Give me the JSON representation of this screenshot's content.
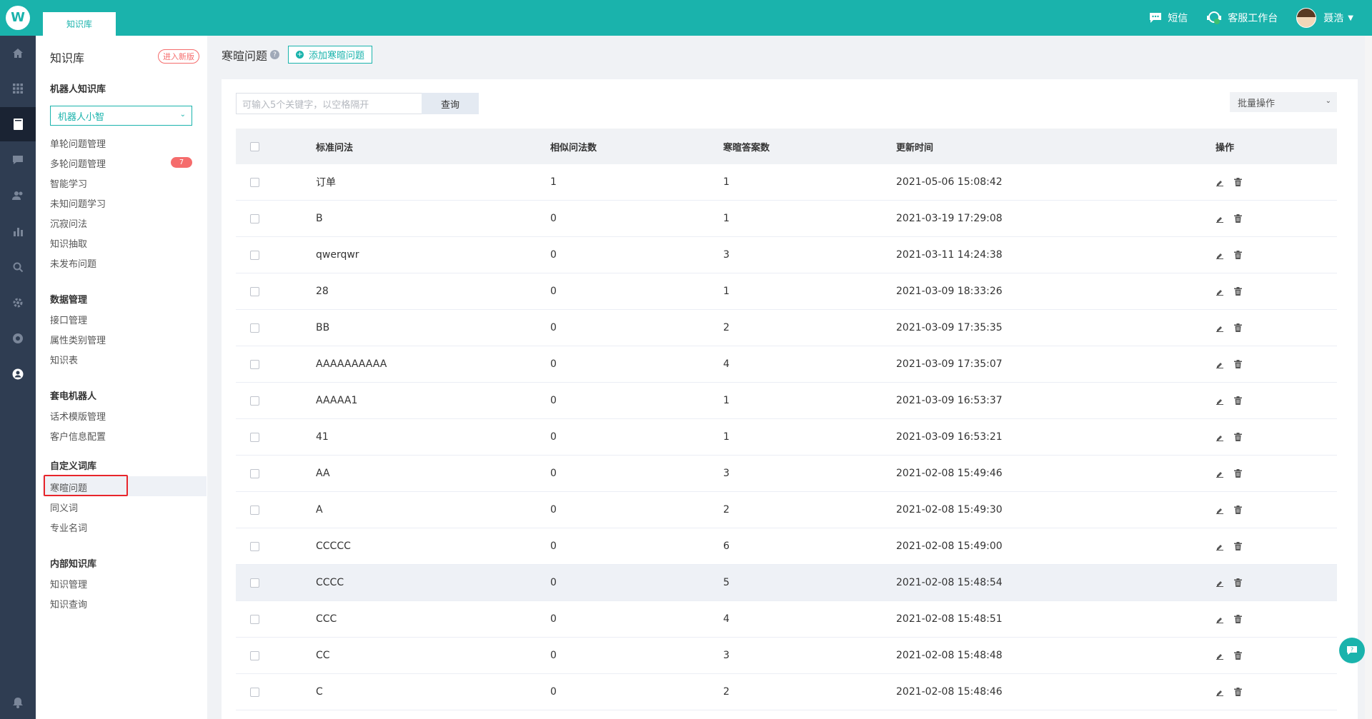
{
  "app": {
    "logo_icon": "tooth-logo-icon",
    "tab_label": "知识库",
    "accent_color": "#1ab3ac"
  },
  "header": {
    "sms_label": "短信",
    "workbench_label": "客服工作台",
    "user_name": "聂浩"
  },
  "rail": {
    "icons": [
      "home-icon",
      "apps-icon",
      "book-icon",
      "chat-icon",
      "users-icon",
      "chart-icon",
      "search-icon",
      "settings-icon",
      "target-icon",
      "user-circle-icon"
    ],
    "bell_icon": "bell-icon"
  },
  "sidebar": {
    "title": "知识库",
    "new_version_label": "进入新版",
    "robot_section": "机器人知识库",
    "robot_select": "机器人小智",
    "robot_items": [
      "单轮问题管理",
      "多轮问题管理",
      "智能学习",
      "未知问题学习",
      "沉寂问法",
      "知识抽取",
      "未发布问题"
    ],
    "multi_badge": "7",
    "data_section": "数据管理",
    "data_items": [
      "接口管理",
      "属性类别管理",
      "知识表"
    ],
    "call_section": "套电机器人",
    "call_items": [
      "话术模版管理",
      "客户信息配置"
    ],
    "custom_section": "自定义词库",
    "custom_items": [
      "寒暄问题",
      "同义词",
      "专业名词"
    ],
    "internal_section": "内部知识库",
    "internal_items": [
      "知识管理",
      "知识查询"
    ]
  },
  "main": {
    "title": "寒暄问题",
    "help_glyph": "?",
    "add_button": "添加寒暄问题",
    "search_placeholder": "可输入5个关键字，以空格隔开",
    "search_button": "查询",
    "batch_label": "批量操作",
    "columns": [
      "标准问法",
      "相似问法数",
      "寒暄答案数",
      "更新时间",
      "操作"
    ],
    "rows": [
      {
        "q": "订单",
        "sim": "1",
        "ans": "1",
        "time": "2021-05-06 15:08:42"
      },
      {
        "q": "B",
        "sim": "0",
        "ans": "1",
        "time": "2021-03-19 17:29:08"
      },
      {
        "q": "qwerqwr",
        "sim": "0",
        "ans": "3",
        "time": "2021-03-11 14:24:38"
      },
      {
        "q": "28",
        "sim": "0",
        "ans": "1",
        "time": "2021-03-09 18:33:26"
      },
      {
        "q": "BB",
        "sim": "0",
        "ans": "2",
        "time": "2021-03-09 17:35:35"
      },
      {
        "q": "AAAAAAAAAA",
        "sim": "0",
        "ans": "4",
        "time": "2021-03-09 17:35:07"
      },
      {
        "q": "AAAAA1",
        "sim": "0",
        "ans": "1",
        "time": "2021-03-09 16:53:37"
      },
      {
        "q": "41",
        "sim": "0",
        "ans": "1",
        "time": "2021-03-09 16:53:21"
      },
      {
        "q": "AA",
        "sim": "0",
        "ans": "3",
        "time": "2021-02-08 15:49:46"
      },
      {
        "q": "A",
        "sim": "0",
        "ans": "2",
        "time": "2021-02-08 15:49:30"
      },
      {
        "q": "CCCCC",
        "sim": "0",
        "ans": "6",
        "time": "2021-02-08 15:49:00"
      },
      {
        "q": "CCCC",
        "sim": "0",
        "ans": "5",
        "time": "2021-02-08 15:48:54"
      },
      {
        "q": "CCC",
        "sim": "0",
        "ans": "4",
        "time": "2021-02-08 15:48:51"
      },
      {
        "q": "CC",
        "sim": "0",
        "ans": "3",
        "time": "2021-02-08 15:48:48"
      },
      {
        "q": "C",
        "sim": "0",
        "ans": "2",
        "time": "2021-02-08 15:48:46"
      }
    ]
  },
  "float_help_icon": "help-chat-icon"
}
